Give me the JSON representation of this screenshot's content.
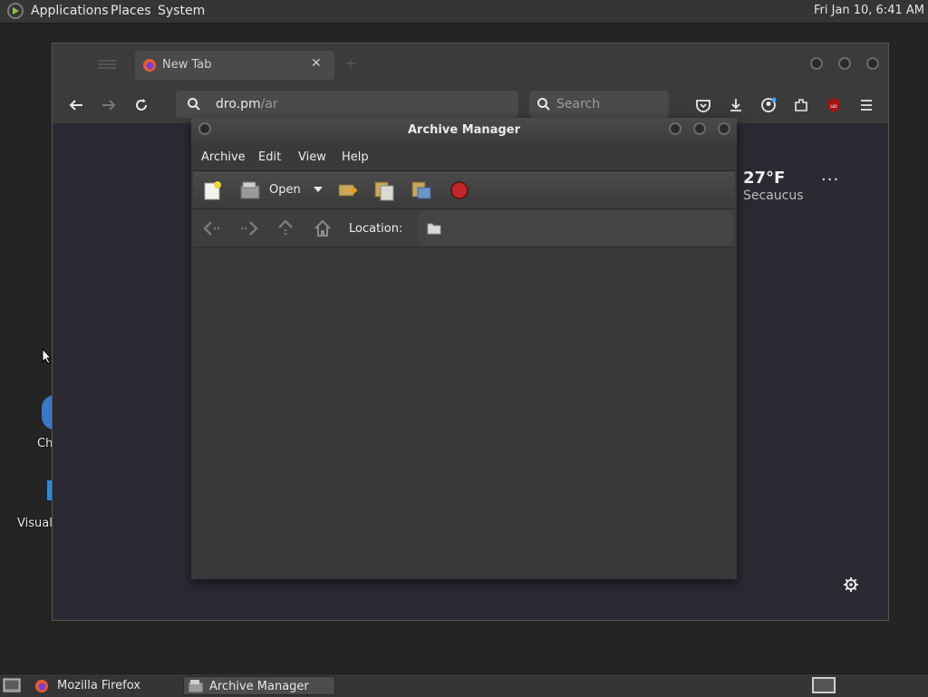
{
  "top_panel": {
    "menus": [
      "Applications",
      "Places",
      "System"
    ],
    "clock": "Fri Jan 10,  6:41 AM"
  },
  "desktop": {
    "icon_labels": [
      "Ch",
      "Visual"
    ]
  },
  "firefox": {
    "tab_title": "New Tab",
    "url_host": "dro.pm",
    "url_path": "/ar",
    "search_placeholder": "Search",
    "weather": {
      "temperature": "27°F",
      "city": "Secaucus",
      "more": "···"
    }
  },
  "archive_manager": {
    "title": "Archive Manager",
    "menus": [
      "Archive",
      "Edit",
      "View",
      "Help"
    ],
    "open_label": "Open",
    "location_label": "Location:"
  },
  "taskbar": {
    "items": [
      "Mozilla Firefox",
      "Archive Manager"
    ]
  },
  "colors": {
    "stop_red": "#c0262c",
    "ublock_red": "#a01515",
    "folder_tan": "#c8a860"
  }
}
